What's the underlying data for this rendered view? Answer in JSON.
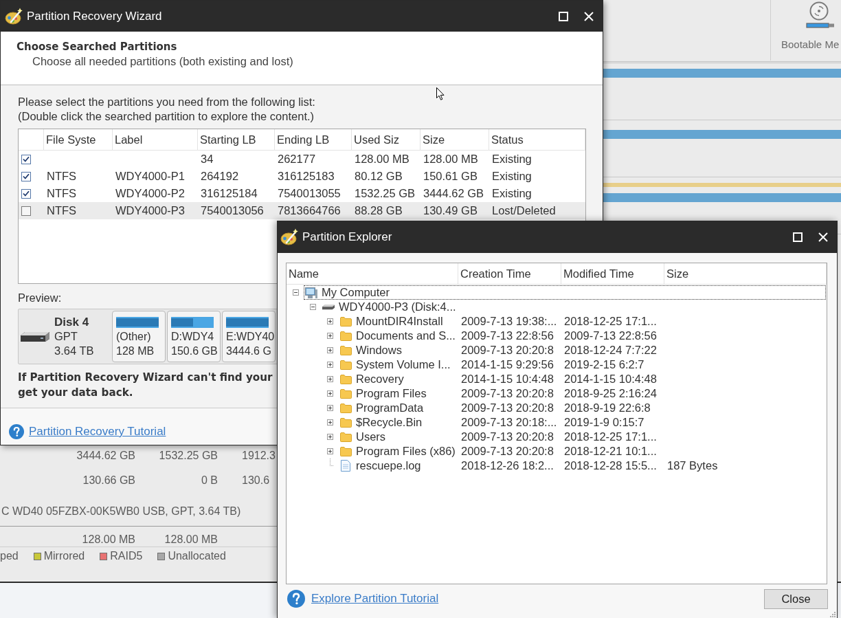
{
  "background_app": {
    "toolbar": [
      {
        "label": "Bootable Me"
      }
    ],
    "disk_map": [
      {
        "bars": [
          {
            "kind": "bar",
            "color": "#64a5d1"
          }
        ]
      },
      {
        "bars": [
          {
            "kind": "bar",
            "color": "#64a5d1"
          }
        ]
      },
      {
        "bars": [
          {
            "kind": "strip",
            "color": "#e8cf8a"
          },
          {
            "kind": "bar",
            "color": "#64a5d1"
          }
        ]
      }
    ],
    "partition_rows": [
      {
        "kind": "partition",
        "cells": [
          "3444.62 GB",
          "1532.25 GB",
          "1912.3"
        ]
      },
      {
        "kind": "partition",
        "cells": [
          "130.66 GB",
          "0 B",
          "130.6"
        ]
      },
      {
        "kind": "disk",
        "label": "C WD40 05FZBX-00K5WB0 USB, GPT, 3.64 TB)"
      },
      {
        "kind": "partition",
        "cells": [
          "128.00 MB",
          "128.00 MB"
        ]
      }
    ],
    "legend": [
      {
        "label": "ped"
      },
      {
        "label": "Mirrored",
        "color": "#c8c83a"
      },
      {
        "label": "RAID5",
        "color": "#e87272"
      },
      {
        "label": "Unallocated",
        "color": "#a8a8a8"
      }
    ]
  },
  "wizard": {
    "title": "Partition Recovery Wizard",
    "heading": "Choose Searched Partitions",
    "subheading": "Choose all needed partitions (both existing and lost)",
    "instructions": [
      "Please select the partitions you need from the following list:",
      "(Double click the searched partition to explore the content.)"
    ],
    "table": {
      "columns": [
        "File Syste",
        "Label",
        "Starting LB",
        "Ending LB",
        "Used Siz",
        "Size",
        "Status"
      ],
      "rows": [
        {
          "checked": true,
          "selected": false,
          "starting_lba": "34",
          "ending_lba": "262177",
          "used_size": "128.00 MB",
          "size": "128.00 MB",
          "status": "Existing"
        },
        {
          "checked": true,
          "selected": false,
          "file_system": "NTFS",
          "label": "WDY4000-P1",
          "starting_lba": "264192",
          "ending_lba": "316125183",
          "used_size": "80.12 GB",
          "size": "150.61 GB",
          "status": "Existing"
        },
        {
          "checked": true,
          "selected": false,
          "file_system": "NTFS",
          "label": "WDY4000-P2",
          "starting_lba": "316125184",
          "ending_lba": "7540013055",
          "used_size": "1532.25 GB",
          "size": "3444.62 GB",
          "status": "Existing"
        },
        {
          "checked": false,
          "selected": true,
          "file_system": "NTFS",
          "label": "WDY4000-P3",
          "starting_lba": "7540013056",
          "ending_lba": "7813664766",
          "used_size": "88.28 GB",
          "size": "130.49 GB",
          "status": "Lost/Deleted"
        }
      ]
    },
    "preview": {
      "label": "Preview:",
      "disk": {
        "name": "Disk 4",
        "type": "GPT",
        "size": "3.64 TB"
      },
      "partitions": [
        {
          "label": "(Other)",
          "size": "128 MB",
          "level": 1
        },
        {
          "label": "D:WDY4",
          "size": "150.6 GB",
          "level": 0.52
        },
        {
          "label": "E:WDY40",
          "size": "3444.6 G",
          "level": 1
        }
      ]
    },
    "warning": [
      "If Partition Recovery Wizard can't find your",
      "get your data back."
    ],
    "tutorial_link": "Partition Recovery Tutorial"
  },
  "explorer": {
    "title": "Partition Explorer",
    "columns": [
      "Name",
      "Creation Time",
      "Modified Time",
      "Size"
    ],
    "tree": [
      {
        "name": "My Computer",
        "kind": "computer",
        "expanded": true,
        "selected": true,
        "children": [
          {
            "name": "WDY4000-P3 (Disk:4...",
            "kind": "drive",
            "expanded": true,
            "selected": false,
            "children": [
              {
                "name": "MountDIR4Install",
                "kind": "folder",
                "expanded": false,
                "selected": false,
                "created": "2009-7-13 19:38:...",
                "modified": "2018-12-25 17:1..."
              },
              {
                "name": "Documents and S...",
                "kind": "folder",
                "expanded": false,
                "selected": false,
                "created": "2009-7-13 22:8:56",
                "modified": "2009-7-13 22:8:56"
              },
              {
                "name": "Windows",
                "kind": "folder",
                "expanded": false,
                "selected": false,
                "created": "2009-7-13 20:20:8",
                "modified": "2018-12-24 7:7:22"
              },
              {
                "name": "System Volume I...",
                "kind": "folder",
                "expanded": false,
                "selected": false,
                "created": "2014-1-15 9:29:56",
                "modified": "2019-2-15 6:2:7"
              },
              {
                "name": "Recovery",
                "kind": "folder",
                "expanded": false,
                "selected": false,
                "created": "2014-1-15 10:4:48",
                "modified": "2014-1-15 10:4:48"
              },
              {
                "name": "Program Files",
                "kind": "folder",
                "expanded": false,
                "selected": false,
                "created": "2009-7-13 20:20:8",
                "modified": "2018-9-25 2:16:24"
              },
              {
                "name": "ProgramData",
                "kind": "folder",
                "expanded": false,
                "selected": false,
                "created": "2009-7-13 20:20:8",
                "modified": "2018-9-19 22:6:8"
              },
              {
                "name": "$Recycle.Bin",
                "kind": "folder",
                "expanded": false,
                "selected": false,
                "created": "2009-7-13 20:18:...",
                "modified": "2019-1-9 0:15:7"
              },
              {
                "name": "Users",
                "kind": "folder",
                "expanded": false,
                "selected": false,
                "created": "2009-7-13 20:20:8",
                "modified": "2018-12-25 17:1..."
              },
              {
                "name": "Program Files (x86)",
                "kind": "folder",
                "expanded": false,
                "selected": false,
                "created": "2009-7-13 20:20:8",
                "modified": "2018-12-21 10:1..."
              },
              {
                "name": "rescuepe.log",
                "kind": "file",
                "selected": false,
                "created": "2018-12-26 18:2...",
                "modified": "2018-12-28 15:5...",
                "size": "187 Bytes"
              }
            ]
          }
        ]
      }
    ],
    "tutorial_link": "Explore Partition Tutorial",
    "close_button": "Close"
  }
}
